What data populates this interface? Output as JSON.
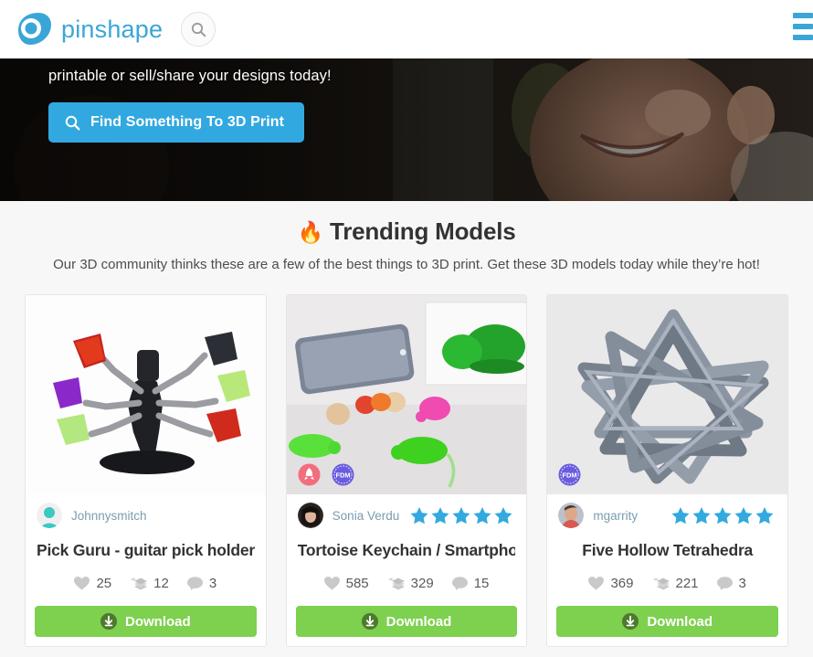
{
  "header": {
    "brand": "pinshape",
    "search_icon": "search-icon",
    "menu_icon": "hamburger-menu-icon",
    "brand_color": "#3aa6d8"
  },
  "hero": {
    "subtitle": "printable or sell/share your designs today!",
    "cta_label": "Find Something To 3D Print",
    "cta_icon": "search-icon",
    "cta_color": "#32a8e0"
  },
  "trending": {
    "fire_icon": "🔥",
    "title": "Trending Models",
    "subtitle": "Our 3D community thinks these are a few of the best things to 3D print. Get these 3D models today while they’re hot!"
  },
  "cards": [
    {
      "author": "Johnnysmitch",
      "title": "Pick Guru - guitar pick holder/...",
      "likes": "25",
      "prints": "12",
      "comments": "3",
      "rating": 0,
      "badges": [],
      "download_label": "Download",
      "avatar_type": "default-teal-avatar",
      "image_alt": "guitar-pick-holder-photo"
    },
    {
      "author": "Sonia Verdu",
      "title": "Tortoise Keychain / Smartpho...",
      "likes": "585",
      "prints": "329",
      "comments": "15",
      "rating": 5,
      "badges": [
        "rocket-badge",
        "fdm-badge"
      ],
      "download_label": "Download",
      "avatar_type": "photo-avatar-woman",
      "image_alt": "tortoise-keychain-phone-stand-photo"
    },
    {
      "author": "mgarrity",
      "title": "Five Hollow Tetrahedra",
      "likes": "369",
      "prints": "221",
      "comments": "3",
      "rating": 5,
      "badges": [
        "fdm-badge"
      ],
      "download_label": "Download",
      "avatar_type": "photo-avatar-man",
      "image_alt": "five-hollow-tetrahedra-photo"
    }
  ],
  "colors": {
    "star": "#33a9e0",
    "download": "#7ed04f",
    "fdm_badge": "#6a5ce0",
    "rocket_badge": "#f26d7d",
    "page_bg": "#f7f7f7"
  }
}
